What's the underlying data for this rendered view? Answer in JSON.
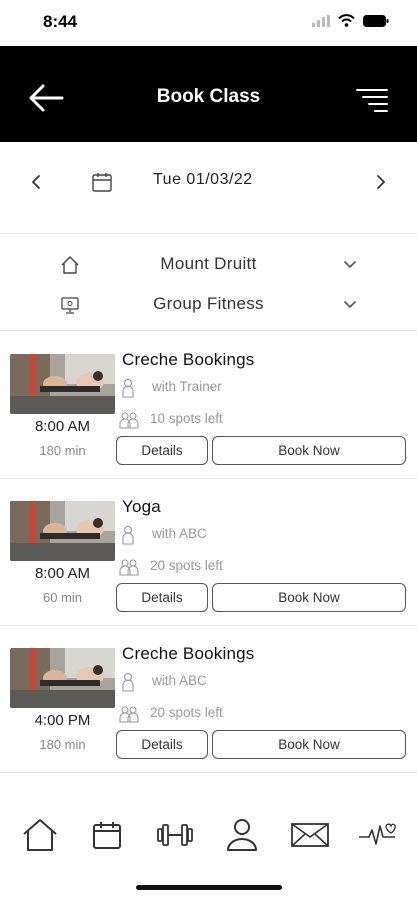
{
  "status": {
    "time": "8:44"
  },
  "header": {
    "title": "Book Class"
  },
  "date": {
    "label": "Tue 01/03/22"
  },
  "filters": [
    {
      "label": "Mount Druitt",
      "icon": "home-icon"
    },
    {
      "label": "Group Fitness",
      "icon": "monitor-icon"
    }
  ],
  "classes": [
    {
      "name": "Creche Bookings",
      "time": "8:00 AM",
      "duration": "180 min",
      "trainer": "with Trainer",
      "spots": "10 spots left",
      "details_label": "Details",
      "book_label": "Book Now"
    },
    {
      "name": "Yoga",
      "time": "8:00 AM",
      "duration": "60 min",
      "trainer": "with ABC",
      "spots": "20 spots left",
      "details_label": "Details",
      "book_label": "Book Now"
    },
    {
      "name": "Creche Bookings",
      "time": "4:00 PM",
      "duration": "180 min",
      "trainer": "with ABC",
      "spots": "20 spots left",
      "details_label": "Details",
      "book_label": "Book Now"
    }
  ],
  "tabs": [
    {
      "icon": "home-icon"
    },
    {
      "icon": "calendar-icon"
    },
    {
      "icon": "dumbbell-icon"
    },
    {
      "icon": "user-icon"
    },
    {
      "icon": "mail-icon"
    },
    {
      "icon": "heart-rate-icon"
    }
  ],
  "colors": {
    "header_bg": "#000000",
    "header_text": "#ffffff",
    "muted_text": "#999999"
  }
}
